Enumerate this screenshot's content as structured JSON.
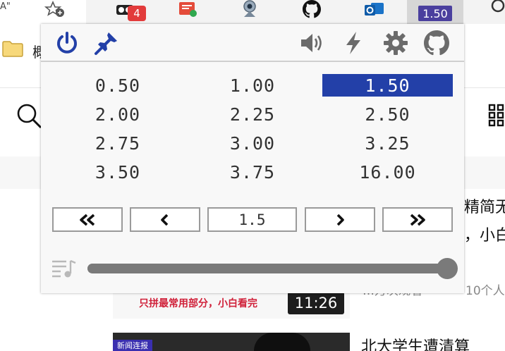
{
  "browser": {
    "tab_fragment": "A\"",
    "bookmark_label": "概",
    "notification_badge": "4",
    "extension_badge": "1.50"
  },
  "feed": {
    "headline_1": "精简无",
    "headline_1b": "，小白",
    "meta_1": "10个人",
    "meta_1_prefix": "…万次观看",
    "thumb1_caption": "只拼最常用部分，小白看完",
    "duration": "11:26",
    "thumb2_tag": "新闻连报",
    "headline_2": "北大学生遭清算"
  },
  "popup": {
    "header_icons": [
      "power-icon",
      "pin-icon",
      "volume-icon",
      "lightning-icon",
      "gear-icon",
      "github-icon"
    ],
    "speed_presets": [
      "0.50",
      "1.00",
      "1.50",
      "2.00",
      "2.25",
      "2.50",
      "2.75",
      "3.00",
      "3.25",
      "3.50",
      "3.75",
      "16.00"
    ],
    "active_speed": "1.50",
    "speed_input_value": "1.5",
    "step_buttons": [
      "fast-rewind",
      "step-down",
      "step-up",
      "fast-forward"
    ],
    "slider_level_fraction": 1.0
  },
  "colors": {
    "accent_blue": "#2340a8",
    "icon_gray": "#6b6b6b",
    "badge_purple": "#4a3f9e",
    "badge_red": "#e23b3b"
  }
}
